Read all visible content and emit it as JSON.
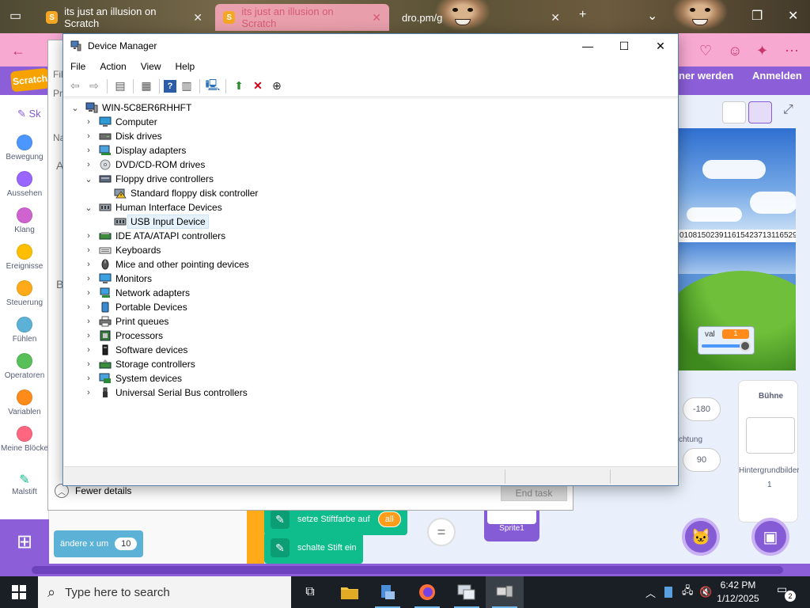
{
  "browser": {
    "tabs": [
      {
        "label": "its just an illusion on Scratch",
        "active": false
      },
      {
        "label": "its just an illusion on Scratch",
        "active": true
      },
      {
        "label": "dro.pm/g",
        "active": false
      }
    ]
  },
  "scratch": {
    "menu": {
      "join": "ner werden",
      "signin": "Anmelden"
    },
    "tab_fragment": "Sk",
    "categories": [
      {
        "label": "Bewegung",
        "color": "#4c97ff"
      },
      {
        "label": "Aussehen",
        "color": "#9966ff"
      },
      {
        "label": "Klang",
        "color": "#cf63cf"
      },
      {
        "label": "Ereignisse",
        "color": "#ffbf00"
      },
      {
        "label": "Steuerung",
        "color": "#ffab19"
      },
      {
        "label": "Fühlen",
        "color": "#5cb1d6"
      },
      {
        "label": "Operatoren",
        "color": "#59c059"
      },
      {
        "label": "Variablen",
        "color": "#ff8c1a"
      },
      {
        "label": "Meine Blöcke",
        "color": "#ff6680"
      },
      {
        "label": "Malstift",
        "color": "#0fbd8c"
      }
    ],
    "blocks": {
      "pen_color": "setze Stiftfarbe auf",
      "pen_color_value": "all",
      "pen_on": "schalte Stift ein",
      "change_x": "ändere x um",
      "change_x_value": "10",
      "equals": "="
    },
    "stage_number_strip": "0108150239116154237131165294",
    "monitor": {
      "label": "val",
      "value": "1",
      "slider_fraction": 1.0
    },
    "sprite_info": {
      "direction_value": "-180",
      "direction_label": "chtung",
      "size_value": "90"
    },
    "stage_panel": {
      "title": "Bühne",
      "backdrops_label": "Hintergrundbilder",
      "backdrops_count": "1"
    },
    "sprite_tile": "Sprite1"
  },
  "task_manager": {
    "left_labels": [
      "Fil",
      "Pr",
      "Na",
      "A",
      "B"
    ],
    "fewer_details": "Fewer details",
    "end_task": "End task"
  },
  "device_manager": {
    "title": "Device Manager",
    "menu": [
      "File",
      "Action",
      "View",
      "Help"
    ],
    "root": "WIN-5C8ER6RHHFT",
    "tree": [
      {
        "label": "Computer",
        "expanded": false,
        "icon": "computer-icon"
      },
      {
        "label": "Disk drives",
        "expanded": false,
        "icon": "disk-drive-icon"
      },
      {
        "label": "Display adapters",
        "expanded": false,
        "icon": "display-adapter-icon"
      },
      {
        "label": "DVD/CD-ROM drives",
        "expanded": false,
        "icon": "dvd-icon"
      },
      {
        "label": "Floppy drive controllers",
        "expanded": true,
        "icon": "floppy-controller-icon",
        "children": [
          {
            "label": "Standard floppy disk controller",
            "icon": "warning-device-icon",
            "selected": false
          }
        ]
      },
      {
        "label": "Human Interface Devices",
        "expanded": true,
        "icon": "hid-icon",
        "children": [
          {
            "label": "USB Input Device",
            "icon": "hid-icon",
            "selected": true
          }
        ]
      },
      {
        "label": "IDE ATA/ATAPI controllers",
        "expanded": false,
        "icon": "ide-controller-icon"
      },
      {
        "label": "Keyboards",
        "expanded": false,
        "icon": "keyboard-icon"
      },
      {
        "label": "Mice and other pointing devices",
        "expanded": false,
        "icon": "mouse-icon"
      },
      {
        "label": "Monitors",
        "expanded": false,
        "icon": "monitor-icon"
      },
      {
        "label": "Network adapters",
        "expanded": false,
        "icon": "network-adapter-icon"
      },
      {
        "label": "Portable Devices",
        "expanded": false,
        "icon": "portable-device-icon"
      },
      {
        "label": "Print queues",
        "expanded": false,
        "icon": "printer-icon"
      },
      {
        "label": "Processors",
        "expanded": false,
        "icon": "processor-icon"
      },
      {
        "label": "Software devices",
        "expanded": false,
        "icon": "software-device-icon"
      },
      {
        "label": "Storage controllers",
        "expanded": false,
        "icon": "storage-controller-icon"
      },
      {
        "label": "System devices",
        "expanded": false,
        "icon": "system-device-icon"
      },
      {
        "label": "Universal Serial Bus controllers",
        "expanded": false,
        "icon": "usb-icon"
      }
    ]
  },
  "taskbar": {
    "search_placeholder": "Type here to search",
    "time": "6:42 PM",
    "date": "1/12/2025",
    "notification_count": "2"
  },
  "colors": {
    "scratch_purple": "#8c5fd9",
    "browser_pink": "#f7a9d1",
    "selection": "#e5f1fb",
    "taskbar": "#1a1f26"
  }
}
